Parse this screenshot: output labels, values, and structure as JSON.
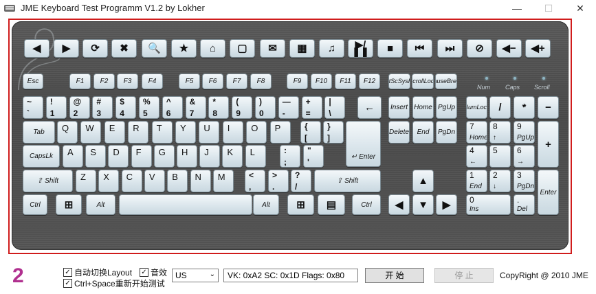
{
  "window": {
    "title": "JME Keyboard Test Programm V1.2 by Lokher",
    "minimize": "—",
    "maximize": "☐",
    "close": "✕"
  },
  "media_row": [
    "◀",
    "▶",
    "⟳",
    "✖",
    "🔍",
    "★",
    "⌂",
    "▢",
    "✉",
    "▦",
    "♫",
    "▶/❚❚",
    "■",
    "⏮",
    "⏭",
    "⊘",
    "◀−",
    "◀+"
  ],
  "fn_row": {
    "esc": "Esc",
    "f": [
      "F1",
      "F2",
      "F3",
      "F4",
      "F5",
      "F6",
      "F7",
      "F8",
      "F9",
      "F10",
      "F11",
      "F12"
    ],
    "prtsc": [
      "PrtSc",
      "SysRq"
    ],
    "scroll": [
      "Scroll",
      "Lock"
    ],
    "pause": [
      "Pause",
      "Break"
    ]
  },
  "leds": [
    "Num",
    "Caps",
    "Scroll"
  ],
  "number_row": [
    [
      "~",
      "`"
    ],
    [
      "!",
      "1"
    ],
    [
      "@",
      "2"
    ],
    [
      "#",
      "3"
    ],
    [
      "$",
      "4"
    ],
    [
      "%",
      "5"
    ],
    [
      "^",
      "6"
    ],
    [
      "&",
      "7"
    ],
    [
      "*",
      "8"
    ],
    [
      "(",
      "9"
    ],
    [
      ")",
      "0"
    ],
    [
      "—",
      "-"
    ],
    [
      "+",
      "="
    ],
    [
      "|",
      "\\"
    ]
  ],
  "backspace": "←",
  "tab": "Tab",
  "row_q": [
    "Q",
    "W",
    "E",
    "R",
    "T",
    "Y",
    "U",
    "I",
    "O",
    "P"
  ],
  "brackets": [
    [
      "{",
      "["
    ],
    [
      "}",
      "]"
    ]
  ],
  "caps": "CapsLk",
  "row_a": [
    "A",
    "S",
    "D",
    "F",
    "G",
    "H",
    "J",
    "K",
    "L"
  ],
  "semi": [
    [
      ":",
      ";"
    ],
    [
      "\"",
      "'"
    ]
  ],
  "enter": "Enter",
  "shift": "Shift",
  "row_z": [
    "Z",
    "X",
    "C",
    "V",
    "B",
    "N",
    "M"
  ],
  "punct": [
    [
      "<",
      ","
    ],
    [
      ">",
      "."
    ],
    [
      "?",
      "/"
    ]
  ],
  "ctrl": "Ctrl",
  "alt": "Alt",
  "nav": {
    "insert": "Insert",
    "home": "Home",
    "pgup": "PgUp",
    "delete": "Delete",
    "end": "End",
    "pgdn": "PgDn"
  },
  "arrows": {
    "up": "▲",
    "left": "◀",
    "down": "▼",
    "right": "▶"
  },
  "numpad": {
    "numlock": [
      "Num",
      "Lock"
    ],
    "div": "/",
    "mul": "*",
    "minus": "−",
    "plus": "+",
    "enter": "Enter",
    "n7": [
      "7",
      "Home"
    ],
    "n8": [
      "8",
      "↑"
    ],
    "n9": [
      "9",
      "PgUp"
    ],
    "n4": [
      "4",
      "←"
    ],
    "n5": [
      "5",
      ""
    ],
    "n6": [
      "6",
      "→"
    ],
    "n1": [
      "1",
      "End"
    ],
    "n2": [
      "2",
      "↓"
    ],
    "n3": [
      "3",
      "PgDn"
    ],
    "n0": [
      "0",
      "Ins"
    ],
    "dot": [
      ".",
      "Del"
    ]
  },
  "bottom": {
    "number_badge": "2",
    "auto_switch": "自动切换Layout",
    "sound": "音效",
    "restart": "Ctrl+Space重新开始测试",
    "layout_value": "US",
    "status": "VK: 0xA2  SC: 0x1D  Flags: 0x80",
    "start": "开 始",
    "stop": "停 止",
    "copyright": "CopyRight @ 2010 JME"
  },
  "colors": {
    "frame": "#d01c1c",
    "keyboard": "#4f4f4f",
    "badge": "#b0308f"
  }
}
